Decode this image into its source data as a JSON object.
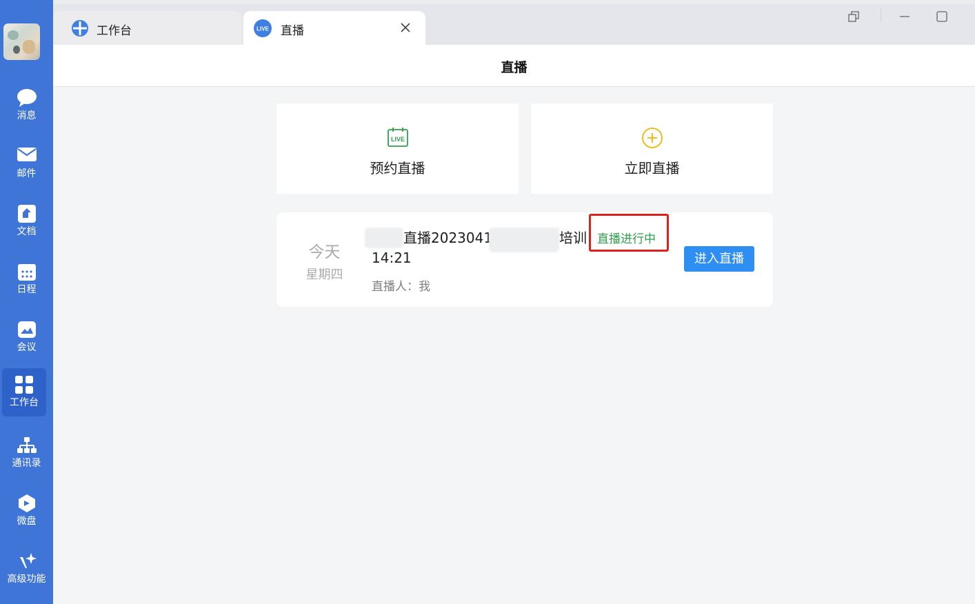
{
  "colors": {
    "sidebar": "#3f75d7",
    "accent": "#2e8ef2",
    "status_live": "#2fa04a",
    "highlight": "#e0201d"
  },
  "sidebar": {
    "items": [
      {
        "label": "消息",
        "icon": "chat-bubble-icon"
      },
      {
        "label": "邮件",
        "icon": "mail-icon"
      },
      {
        "label": "文档",
        "icon": "document-icon"
      },
      {
        "label": "日程",
        "icon": "calendar-icon"
      },
      {
        "label": "会议",
        "icon": "meeting-icon"
      },
      {
        "label": "工作台",
        "icon": "workbench-grid-icon",
        "active": true
      },
      {
        "label": "通讯录",
        "icon": "org-chart-icon"
      },
      {
        "label": "微盘",
        "icon": "cloud-drive-icon"
      },
      {
        "label": "高级功能",
        "icon": "sparkle-icon"
      }
    ]
  },
  "tabs": [
    {
      "label": "工作台",
      "icon": "workbench-plus-icon"
    },
    {
      "label": "直播",
      "icon": "live-badge-icon",
      "icon_text": "LIVE",
      "active": true
    }
  ],
  "page": {
    "title": "直播"
  },
  "actions": {
    "schedule": {
      "label": "预约直播",
      "icon": "live-calendar-icon",
      "icon_text": "LIVE"
    },
    "start_now": {
      "label": "立即直播",
      "icon": "plus-circle-icon"
    }
  },
  "session": {
    "day": "今天",
    "weekday": "星期四",
    "title_part1": "直播2023041",
    "title_part2": "培训",
    "time": "14:21",
    "host": "直播人：我",
    "status": "直播进行中",
    "enter_label": "进入直播"
  }
}
